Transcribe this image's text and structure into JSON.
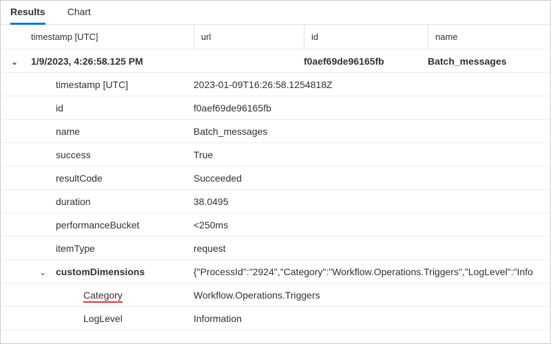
{
  "tabs": {
    "results": "Results",
    "chart": "Chart"
  },
  "headers": {
    "timestamp": "timestamp [UTC]",
    "url": "url",
    "id": "id",
    "name": "name"
  },
  "row": {
    "timestamp_display": "1/9/2023, 4:26:58.125 PM",
    "url": "",
    "id": "f0aef69de96165fb",
    "name": "Batch_messages"
  },
  "details": {
    "timestamp_label": "timestamp [UTC]",
    "timestamp_value": "2023-01-09T16:26:58.1254818Z",
    "id_label": "id",
    "id_value": "f0aef69de96165fb",
    "name_label": "name",
    "name_value": "Batch_messages",
    "success_label": "success",
    "success_value": "True",
    "resultCode_label": "resultCode",
    "resultCode_value": "Succeeded",
    "duration_label": "duration",
    "duration_value": "38.0495",
    "performanceBucket_label": "performanceBucket",
    "performanceBucket_value": "<250ms",
    "itemType_label": "itemType",
    "itemType_value": "request",
    "customDimensions_label": "customDimensions",
    "customDimensions_value": "{\"ProcessId\":\"2924\",\"Category\":\"Workflow.Operations.Triggers\",\"LogLevel\":\"Info"
  },
  "sub": {
    "category_label": "Category",
    "category_value": "Workflow.Operations.Triggers",
    "loglevel_label": "LogLevel",
    "loglevel_value": "Information"
  }
}
